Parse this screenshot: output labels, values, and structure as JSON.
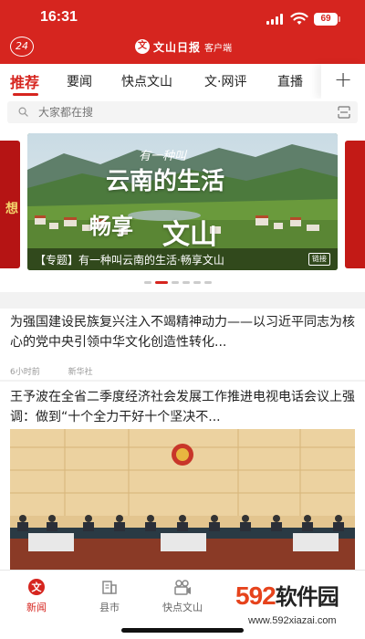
{
  "status_bar": {
    "time": "16:31",
    "battery": "69"
  },
  "header": {
    "day_badge": "24",
    "logo_char": "文",
    "brand_name": "文山日报",
    "brand_sub": "客户端"
  },
  "tabs": [
    {
      "label": "推荐",
      "active": true
    },
    {
      "label": "要闻"
    },
    {
      "label": "快点文山"
    },
    {
      "label": "文·网评"
    },
    {
      "label": "直播"
    }
  ],
  "tab_more": "+",
  "search": {
    "placeholder": "大家都在搜"
  },
  "carousel": {
    "slide_text_top": "有一种叫",
    "slide_text_mid": "云南的生活",
    "slide_text_bottom_a": "畅享",
    "slide_text_bottom_b": "文山",
    "caption": "【专题】有一种叫云南的生活·畅享文山",
    "tag": "链接",
    "left_card_char": "想",
    "dots": 6,
    "active_dot": 1
  },
  "news": [
    {
      "title": "为强国建设民族复兴注入不竭精神动力——以习近平同志为核心的党中央引领中华文化创造性转化...",
      "time": "6小时前",
      "source": "新华社"
    },
    {
      "title": "王予波在全省二季度经济社会发展工作推进电视电话会议上强调：做到“十个全力干好十个坚决不..."
    }
  ],
  "bottom_nav": [
    {
      "label": "新闻",
      "icon": "news-icon",
      "active": true
    },
    {
      "label": "县市",
      "icon": "county-icon"
    },
    {
      "label": "快点文山",
      "icon": "video-icon"
    }
  ],
  "watermark": {
    "num": "592",
    "cn": "软件园",
    "url": "www.592xiazai.com"
  },
  "colors": {
    "brand_red": "#d6251f",
    "watermark_orange": "#e6431c"
  }
}
